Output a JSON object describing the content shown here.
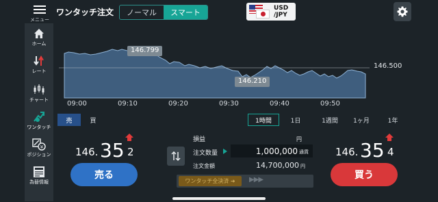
{
  "header": {
    "menu_label": "メニュー",
    "title": "ワンタッチ注文",
    "mode_tabs": [
      {
        "label": "ノーマル",
        "active": false
      },
      {
        "label": "スマート",
        "active": true
      }
    ],
    "pair_line1": "USD",
    "pair_line2": "/JPY"
  },
  "sidebar": {
    "items": [
      {
        "label": "ホーム",
        "icon": "home-icon"
      },
      {
        "label": "レート",
        "icon": "rate-icon"
      },
      {
        "label": "チャート",
        "icon": "candlestick-icon"
      },
      {
        "label": "ワンタッチ",
        "icon": "one-touch-icon",
        "active": true
      },
      {
        "label": "ポジション",
        "icon": "position-icon"
      },
      {
        "label": "為替情報",
        "icon": "news-icon"
      }
    ]
  },
  "chart_data": {
    "type": "area",
    "x_ticks": [
      "09:00",
      "09:10",
      "09:20",
      "09:30",
      "09:40",
      "09:50"
    ],
    "high_label": "146.799",
    "low_label": "146.210",
    "last_label": "146.500",
    "color": "#4a6f95"
  },
  "chart_controls": {
    "side_tabs": [
      {
        "label": "売",
        "active": true
      },
      {
        "label": "買",
        "active": false
      }
    ],
    "ranges": [
      {
        "label": "1時間",
        "active": true
      },
      {
        "label": "1日",
        "active": false
      },
      {
        "label": "1週間",
        "active": false
      },
      {
        "label": "1ヶ月",
        "active": false
      },
      {
        "label": "1年",
        "active": false
      }
    ]
  },
  "bid": {
    "prefix": "146.",
    "main": "35",
    "pip": "2",
    "button_label": "売る",
    "color": "#2f72c6"
  },
  "ask": {
    "prefix": "146.",
    "main": "35",
    "pip": "4",
    "button_label": "買う",
    "color": "#d9383a"
  },
  "order": {
    "pl_label": "損益",
    "pl_unit": "円",
    "qty_label": "注文数量",
    "qty_value": "1,000,000",
    "qty_unit": "通貨",
    "amount_label": "注文金額",
    "amount_value": "14,700,000",
    "amount_unit": "円",
    "settle_label": "ワンタッチ全決済 ➜",
    "settle_chevrons": "▶▶▶"
  }
}
